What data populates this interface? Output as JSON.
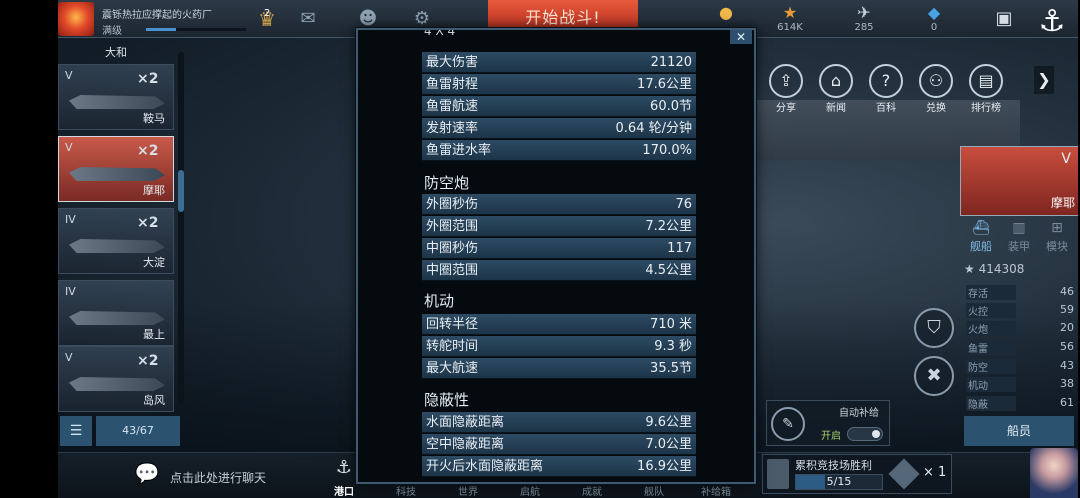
{
  "topbar": {
    "player_name": "震铄热拉应撑起的火药厂",
    "player_status": "满级",
    "rank_number": "2",
    "battle_button": "开始战斗!",
    "resources": [
      {
        "icon": "gold-coin-icon",
        "value": ""
      },
      {
        "icon": "star-icon",
        "value": "614K"
      },
      {
        "icon": "plane-icon",
        "value": "285"
      },
      {
        "icon": "diamond-icon",
        "value": "0"
      }
    ],
    "xp_fraction": 0.3
  },
  "shiplist": {
    "header": "大和",
    "ships": [
      {
        "tier": "V",
        "mult": "×2",
        "name": "鞍马",
        "selected": false
      },
      {
        "tier": "V",
        "mult": "×2",
        "name": "摩耶",
        "selected": true
      },
      {
        "tier": "IV",
        "mult": "×2",
        "name": "大淀",
        "selected": false
      },
      {
        "tier": "IV",
        "mult": "",
        "name": "最上",
        "selected": false
      },
      {
        "tier": "V",
        "mult": "×2",
        "name": "岛风",
        "selected": false
      }
    ],
    "count": "43/67"
  },
  "bottombar": {
    "chat_label": "点击此处进行聊天",
    "nav": [
      {
        "label": "港口",
        "icon": "harbor-icon",
        "active": true
      },
      {
        "label": "科技",
        "icon": "tech-icon",
        "active": false
      },
      {
        "label": "世界",
        "icon": "world-icon",
        "active": false
      },
      {
        "label": "启航",
        "icon": "sail-icon",
        "active": false
      },
      {
        "label": "成就",
        "icon": "achievement-icon",
        "active": false
      },
      {
        "label": "舰队",
        "icon": "fleet-icon",
        "active": false
      },
      {
        "label": "补给箱",
        "icon": "supply-box-icon",
        "active": false
      }
    ]
  },
  "quick_buttons": [
    {
      "label": "分享",
      "icon": "share-icon"
    },
    {
      "label": "新闻",
      "icon": "news-icon"
    },
    {
      "label": "百科",
      "icon": "encyclopedia-icon"
    },
    {
      "label": "兑换",
      "icon": "exchange-icon"
    },
    {
      "label": "排行榜",
      "icon": "leaderboard-icon"
    }
  ],
  "ship_panel": {
    "tier": "V",
    "name": "摩耶",
    "tabs": [
      "舰船",
      "装甲",
      "模块"
    ],
    "power": "414308",
    "stats": [
      {
        "label": "存活",
        "value": "46"
      },
      {
        "label": "火控",
        "value": "59"
      },
      {
        "label": "火炮",
        "value": "20"
      },
      {
        "label": "鱼雷",
        "value": "56"
      },
      {
        "label": "防空",
        "value": "43"
      },
      {
        "label": "机动",
        "value": "38"
      },
      {
        "label": "隐蔽",
        "value": "61"
      }
    ],
    "crew_button": "船员"
  },
  "resupply": {
    "title": "自动补给",
    "state": "开启"
  },
  "arena": {
    "title": "累积竞技场胜利",
    "progress": "5/15",
    "progress_fraction": 0.333,
    "reward_mult": "× 1"
  },
  "modal": {
    "clipped_title": "4 X 4",
    "torpedo_rows": [
      {
        "label": "最大伤害",
        "value": "21120"
      },
      {
        "label": "鱼雷射程",
        "value": "17.6公里"
      },
      {
        "label": "鱼雷航速",
        "value": "60.0节"
      },
      {
        "label": "发射速率",
        "value": "0.64 轮/分钟"
      },
      {
        "label": "鱼雷进水率",
        "value": "170.0%"
      }
    ],
    "sections": [
      {
        "title": "防空炮",
        "rows": [
          {
            "label": "外圈秒伤",
            "value": "76"
          },
          {
            "label": "外圈范围",
            "value": "7.2公里"
          },
          {
            "label": "中圈秒伤",
            "value": "117"
          },
          {
            "label": "中圈范围",
            "value": "4.5公里"
          }
        ]
      },
      {
        "title": "机动",
        "rows": [
          {
            "label": "回转半径",
            "value": "710 米"
          },
          {
            "label": "转舵时间",
            "value": "9.3 秒"
          },
          {
            "label": "最大航速",
            "value": "35.5节"
          }
        ]
      },
      {
        "title": "隐蔽性",
        "rows": [
          {
            "label": "水面隐蔽距离",
            "value": "9.6公里"
          },
          {
            "label": "空中隐蔽距离",
            "value": "7.0公里"
          },
          {
            "label": "开火后水面隐蔽距离",
            "value": "16.9公里"
          }
        ]
      }
    ]
  }
}
